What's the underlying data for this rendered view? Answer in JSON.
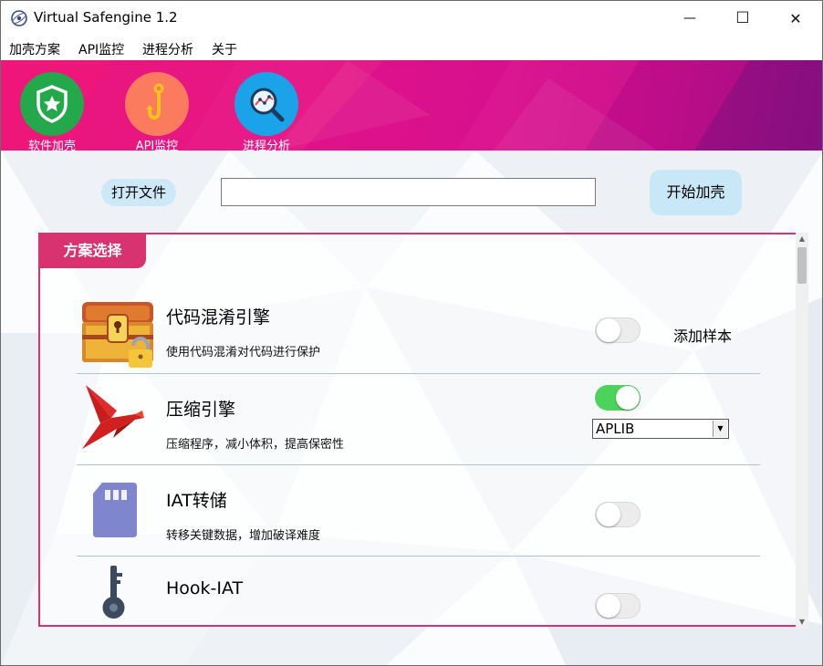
{
  "window": {
    "title": "Virtual Safengine 1.2",
    "minimize_glyph": "—",
    "maximize_glyph": "☐",
    "close_glyph": "✕"
  },
  "menu": [
    "加壳方案",
    "API监控",
    "进程分析",
    "关于"
  ],
  "toolbar": {
    "items": [
      {
        "label": "软件加壳",
        "icon": "shield-star-icon",
        "color": "#23a84b"
      },
      {
        "label": "API监控",
        "icon": "hook-icon",
        "color": "#fb7b5f"
      },
      {
        "label": "进程分析",
        "icon": "magnifier-chart-icon",
        "color": "#1aa3e8"
      }
    ]
  },
  "file": {
    "open_label": "打开文件",
    "path_value": "",
    "start_label": "开始加壳"
  },
  "panel": {
    "tab_label": "方案选择",
    "options": [
      {
        "title": "代码混淆引擎",
        "desc": "使用代码混淆对代码进行保护",
        "icon": "treasure-chest-icon",
        "enabled": false,
        "extra": "添加样本"
      },
      {
        "title": "压缩引擎",
        "desc": "压缩程序，减小体积，提高保密性",
        "icon": "red-bird-icon",
        "enabled": true,
        "select_value": "APLIB"
      },
      {
        "title": "IAT转储",
        "desc": "转移关键数据，增加破译难度",
        "icon": "sd-card-icon",
        "enabled": false
      },
      {
        "title": "Hook-IAT",
        "desc": "",
        "icon": "key-icon",
        "enabled": false
      }
    ]
  },
  "colors": {
    "accent": "#d8336e",
    "toggle_on": "#4cd35b",
    "button_bg": "#cde9f7"
  }
}
